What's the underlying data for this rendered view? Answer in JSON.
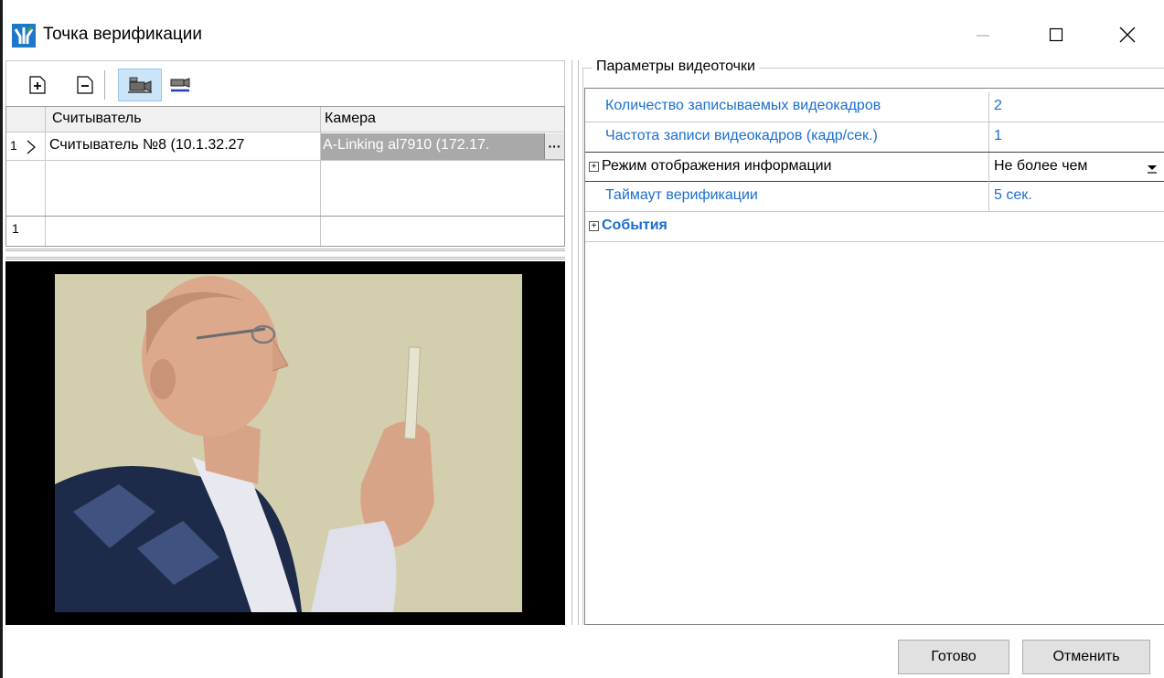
{
  "window": {
    "title": "Точка верификации",
    "controls": [
      "minimize-icon",
      "maximize-icon",
      "close-icon"
    ]
  },
  "toolbar": {
    "buttons": [
      "add-row-icon",
      "remove-row-icon",
      "add-camera-icon",
      "remove-camera-icon"
    ]
  },
  "grid": {
    "columns": [
      "Считыватель",
      "Камера"
    ],
    "rows": [
      {
        "index": "1",
        "reader": "Считыватель №8 (10.1.32.27",
        "camera": "A-Linking al7910 (172.17.",
        "ellipsis": "···"
      }
    ],
    "footer_index": "1"
  },
  "video": {
    "content": "camera-snapshot"
  },
  "params": {
    "group_title": "Параметры видеоточки",
    "rows": [
      {
        "name": "Количество записываемых видеокадров",
        "value": "2"
      },
      {
        "name": "Частота записи видеокадров (кадр/сек.)",
        "value": "1"
      },
      {
        "name": "Режим отображения информации",
        "value": "Не более чем",
        "expandable": "+"
      },
      {
        "name": "Таймаут верификации",
        "value": "5 сек."
      },
      {
        "name": "События",
        "value": "",
        "expandable": "+"
      }
    ]
  },
  "buttons": {
    "ok": "Готово",
    "cancel": "Отменить"
  },
  "colors": {
    "accent_text": "#1a6fd0",
    "selected_cell": "#a9a9a9",
    "icon_blue": "#1e78c8",
    "icon_green": "#3aa64c"
  }
}
